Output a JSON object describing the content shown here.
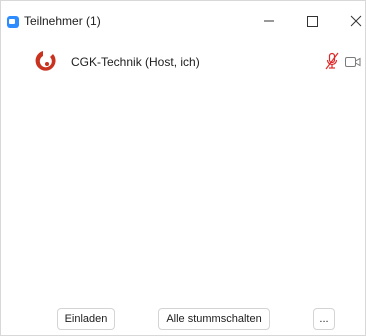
{
  "window": {
    "title": "Teilnehmer (1)"
  },
  "participants": [
    {
      "name": "CGK-Technik (Host, ich)",
      "audio": "muted",
      "video": "off"
    }
  ],
  "footer": {
    "invite_label": "Einladen",
    "mute_all_label": "Alle stummschalten",
    "more_label": "..."
  },
  "icons": {
    "app": "zoom-app-icon",
    "avatar": "avatar-logo",
    "mic": "mic-muted-icon",
    "video": "video-camera-icon"
  },
  "colors": {
    "accent": "#2d8cff",
    "muted_red": "#e02828",
    "avatar_red": "#c8321e",
    "icon_gray": "#7a7a7a"
  }
}
